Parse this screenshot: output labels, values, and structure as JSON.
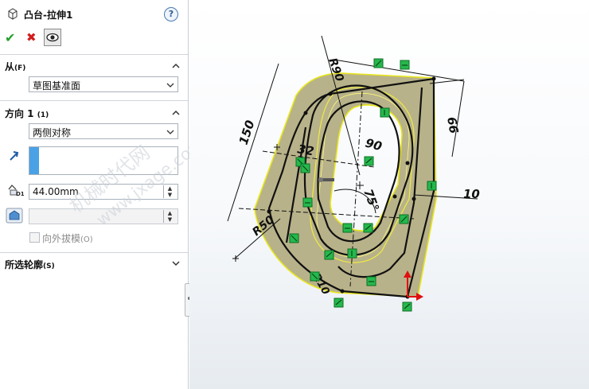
{
  "feature": {
    "title": "凸台-拉伸1",
    "help": "?"
  },
  "from_section": {
    "label": "从",
    "suffix": "(F)",
    "value": "草图基准面"
  },
  "direction1": {
    "label": "方向 1",
    "suffix": "(1)",
    "end_condition": "两侧对称",
    "depth": "44.00mm",
    "draft_label": "向外拔模",
    "draft_suffix": "(O)",
    "draft_checked": false
  },
  "contours": {
    "label": "所选轮廓",
    "suffix": "(S)"
  },
  "watermark": {
    "cn": "机械时代网",
    "url": "www.jxage.com"
  },
  "dimensions": {
    "r90": "R90",
    "d66": "66",
    "d150": "150",
    "d32": "32",
    "d90": "90",
    "d10": "10",
    "r50": "R50",
    "a75": "75°",
    "r10": "R10"
  },
  "colors": {
    "face": "#b5b08a",
    "highlight": "#f0ee20",
    "relation": "#25b84d",
    "arrow_red": "#e01010"
  }
}
